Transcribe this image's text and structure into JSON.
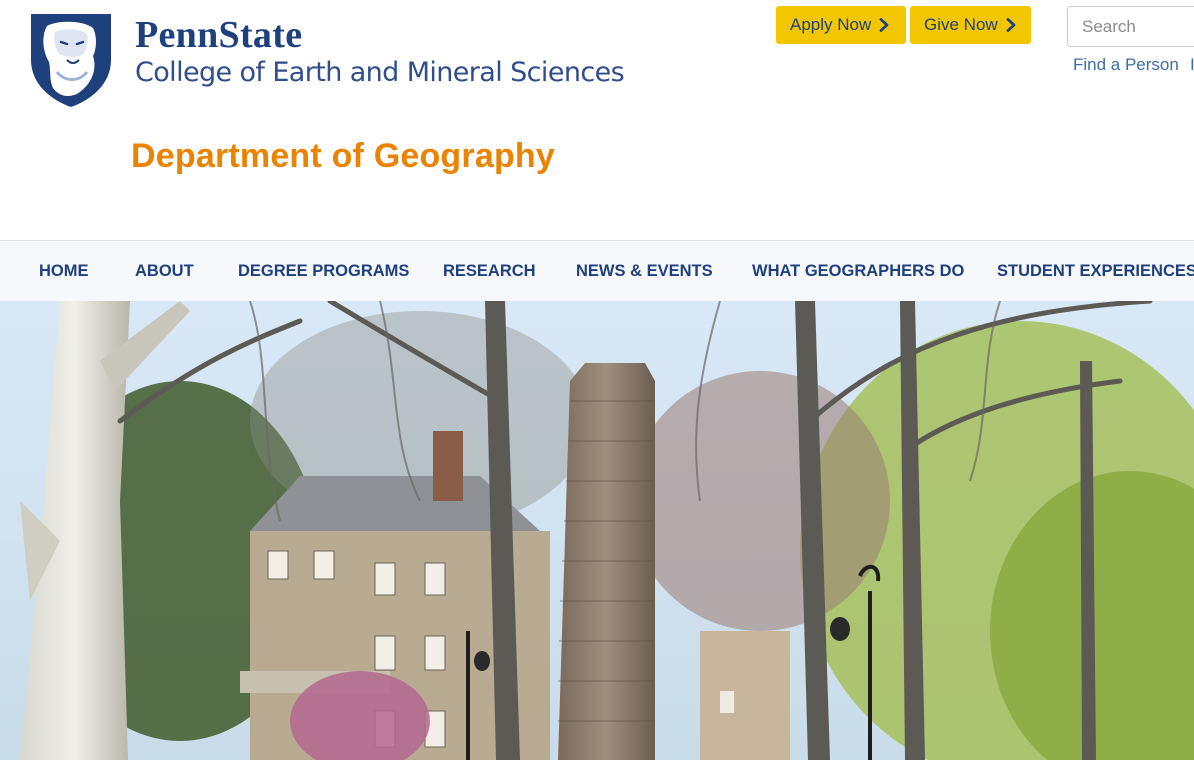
{
  "brand": {
    "logo_icon": "nittany-lion-shield-icon",
    "name": "PennState",
    "college": "College of Earth and Mineral Sciences"
  },
  "department": {
    "title": "Department of Geography"
  },
  "actions": {
    "apply_label": "Apply Now",
    "give_label": "Give Now",
    "chevron_icon": "chevron-right-icon"
  },
  "search": {
    "placeholder": "Search",
    "value": ""
  },
  "utility_links": {
    "find_person": "Find a Person",
    "truncated": "I"
  },
  "nav": {
    "items": [
      {
        "label": "HOME"
      },
      {
        "label": "ABOUT"
      },
      {
        "label": "DEGREE PROGRAMS"
      },
      {
        "label": "RESEARCH"
      },
      {
        "label": "NEWS & EVENTS"
      },
      {
        "label": "WHAT GEOGRAPHERS DO"
      },
      {
        "label": "STUDENT EXPERIENCES"
      }
    ]
  },
  "colors": {
    "navy": "#1e407c",
    "orange": "#e98300",
    "gold": "#f2c600",
    "link": "#3d6ea8",
    "nav_bg": "#f7f8fb"
  }
}
